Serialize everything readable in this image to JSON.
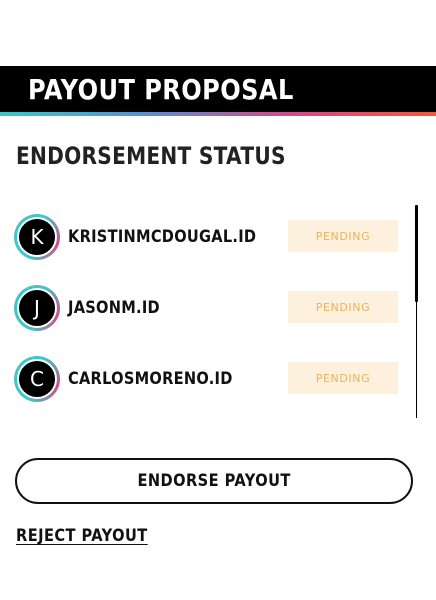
{
  "header": {
    "title": "PAYOUT PROPOSAL",
    "stripe_colors": [
      "#3ec6c9",
      "#5b8fd0",
      "#d34a8a",
      "#f05a3c"
    ]
  },
  "status": {
    "title": "ENDORSEMENT STATUS"
  },
  "endorsers": [
    {
      "initial": "K",
      "name": "KRISTINMCDOUGAL.ID",
      "status": "PENDING"
    },
    {
      "initial": "J",
      "name": "JASONM.ID",
      "status": "PENDING"
    },
    {
      "initial": "C",
      "name": "CARLOSMORENO.ID",
      "status": "PENDING"
    }
  ],
  "colors": {
    "pending_bg": "#fdf0dc",
    "pending_text": "#e8b45c",
    "avatar_ring": "#3ec6c9",
    "avatar_ring_accent": "#d34a8a"
  },
  "actions": {
    "endorse_label": "ENDORSE PAYOUT",
    "reject_label": "REJECT PAYOUT"
  }
}
